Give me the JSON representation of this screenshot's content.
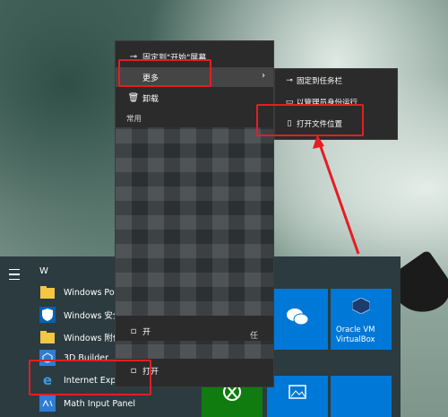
{
  "context_menu": {
    "pin_start": "固定到\"开始\"屏幕",
    "more": "更多",
    "uninstall": "卸载",
    "frequent_header": "常用",
    "partial_items": [
      {
        "text": "开"
      },
      {
        "text": "打开"
      },
      {
        "text": "任"
      }
    ]
  },
  "submenu": {
    "pin_taskbar": "固定到任务栏",
    "run_admin": "以管理员身份运行",
    "open_location": "打开文件位置"
  },
  "start_menu": {
    "group_letter": "W",
    "apps": [
      {
        "label": "Windows Pow",
        "icon": "folder-icon"
      },
      {
        "label": "Windows 安全",
        "icon": "shield-icon"
      },
      {
        "label": "Windows 附件",
        "icon": "folder-icon"
      },
      {
        "label": "3D Builder",
        "icon": "3d-builder-icon"
      },
      {
        "label": "Internet Expl",
        "icon": "internet-explorer-icon"
      },
      {
        "label": "Math Input Panel",
        "icon": "math-input-icon"
      }
    ],
    "tiles": [
      {
        "label": "",
        "icon": "wechat-icon"
      },
      {
        "label": "Oracle VM VirtualBox",
        "icon": "virtualbox-icon"
      },
      {
        "label": "",
        "icon": "xbox-icon"
      },
      {
        "label": "",
        "icon": "photos-icon"
      }
    ]
  },
  "colors": {
    "annotation_red": "#e51d24",
    "tile_blue": "#0078d7",
    "tile_green": "#107c10"
  }
}
